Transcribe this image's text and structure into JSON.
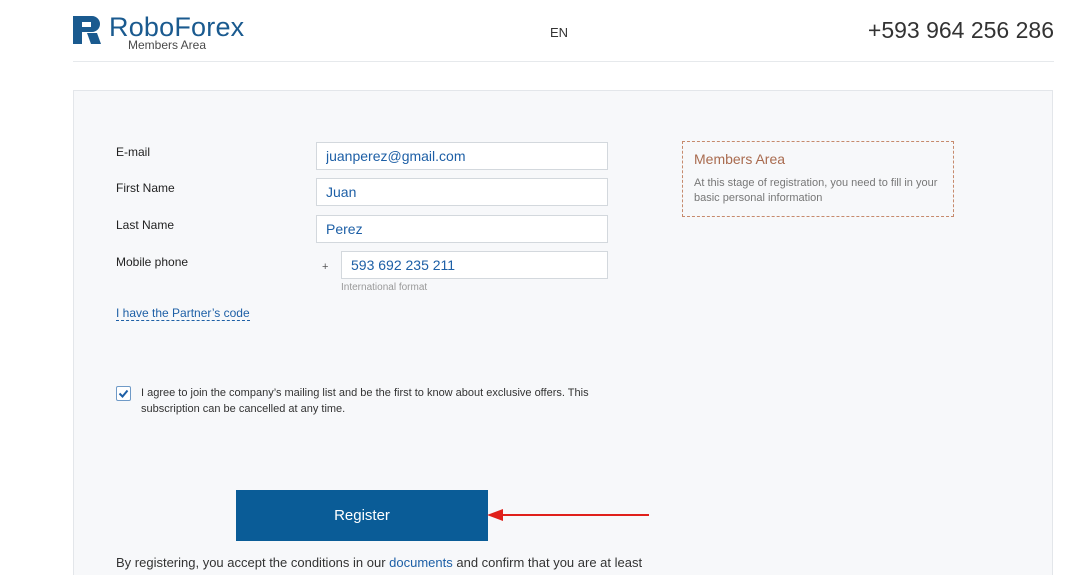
{
  "header": {
    "brand": "RoboForex",
    "brand_sub": "Members Area",
    "language": "EN",
    "phone": "+593 964 256 286"
  },
  "form": {
    "fields": [
      {
        "label": "E-mail",
        "value": "juanperez@gmail.com"
      },
      {
        "label": "First Name",
        "value": "Juan"
      },
      {
        "label": "Last Name",
        "value": "Perez"
      },
      {
        "label": "Mobile phone",
        "value": "593 692 235 211",
        "prefix": "+",
        "hint": "International format"
      }
    ],
    "partner_link": "I have the Partner’s code",
    "consent": {
      "checked": true,
      "text": "I agree to join the company’s mailing list and be the first to know about exclusive offers. This subscription can be cancelled at any time."
    },
    "register_label": "Register",
    "terms": {
      "before": "By registering, you accept the conditions in our ",
      "link": "documents",
      "after": " and confirm that you are at least"
    }
  },
  "info": {
    "title": "Members Area",
    "text": "At this stage of registration, you need to fill in your basic personal information"
  },
  "colors": {
    "brand": "#1a5a8f",
    "button": "#0a5c97",
    "link": "#1d5fa6",
    "arrow": "#e0201b",
    "info_border": "#c68a6d"
  }
}
